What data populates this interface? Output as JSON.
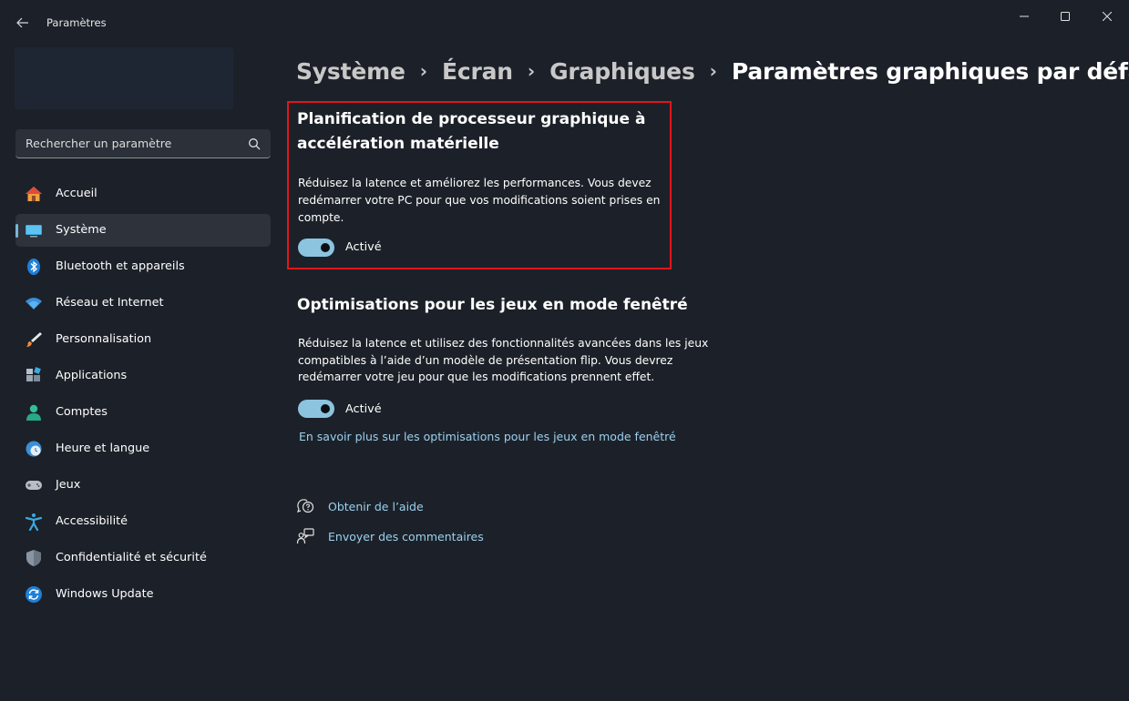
{
  "window": {
    "title": "Paramètres",
    "back_icon": "arrow-left-icon",
    "controls": [
      "minimize-icon",
      "maximize-icon",
      "close-icon"
    ]
  },
  "search": {
    "placeholder": "Rechercher un paramètre",
    "icon": "search-icon"
  },
  "sidebar": {
    "items": [
      {
        "label": "Accueil",
        "icon": "home-icon"
      },
      {
        "label": "Système",
        "icon": "system-display-icon",
        "active": true
      },
      {
        "label": "Bluetooth et appareils",
        "icon": "bluetooth-icon"
      },
      {
        "label": "Réseau et Internet",
        "icon": "wifi-icon"
      },
      {
        "label": "Personnalisation",
        "icon": "paintbrush-icon"
      },
      {
        "label": "Applications",
        "icon": "apps-icon"
      },
      {
        "label": "Comptes",
        "icon": "account-icon"
      },
      {
        "label": "Heure et langue",
        "icon": "clock-globe-icon"
      },
      {
        "label": "Jeux",
        "icon": "gamepad-icon"
      },
      {
        "label": "Accessibilité",
        "icon": "accessibility-icon"
      },
      {
        "label": "Confidentialité et sécurité",
        "icon": "shield-icon"
      },
      {
        "label": "Windows Update",
        "icon": "sync-icon"
      }
    ]
  },
  "breadcrumb": {
    "items": [
      "Système",
      "Écran",
      "Graphiques",
      "Paramètres graphiques par défaut"
    ],
    "separator": "›"
  },
  "sections": {
    "hags": {
      "title_line1": "Planification de processeur graphique à",
      "title_line2": "accélération matérielle",
      "desc_line1": "Réduisez la latence et améliorez les performances. Vous devez",
      "desc_line2": "redémarrer votre PC pour que vos modifications soient prises en",
      "desc_line3": "compte.",
      "toggle_label": "Activé",
      "toggle_on": true
    },
    "windowed_games": {
      "title": "Optimisations pour les jeux en mode fenêtré",
      "desc_line1": "Réduisez la latence et utilisez des fonctionnalités avancées dans les jeux",
      "desc_line2": "compatibles à l’aide d’un modèle de présentation flip. Vous devrez",
      "desc_line3": "redémarrer votre jeu pour que les modifications prennent effet.",
      "toggle_label": "Activé",
      "toggle_on": true,
      "learn_more": "En savoir plus sur les optimisations pour les jeux en mode fenêtré"
    }
  },
  "help": {
    "get_help": "Obtenir de l’aide",
    "feedback": "Envoyer des commentaires"
  },
  "colors": {
    "background": "#1c2129",
    "accent": "#8cc4e0",
    "link": "#9cd0ee",
    "highlight": "#e0161d"
  }
}
